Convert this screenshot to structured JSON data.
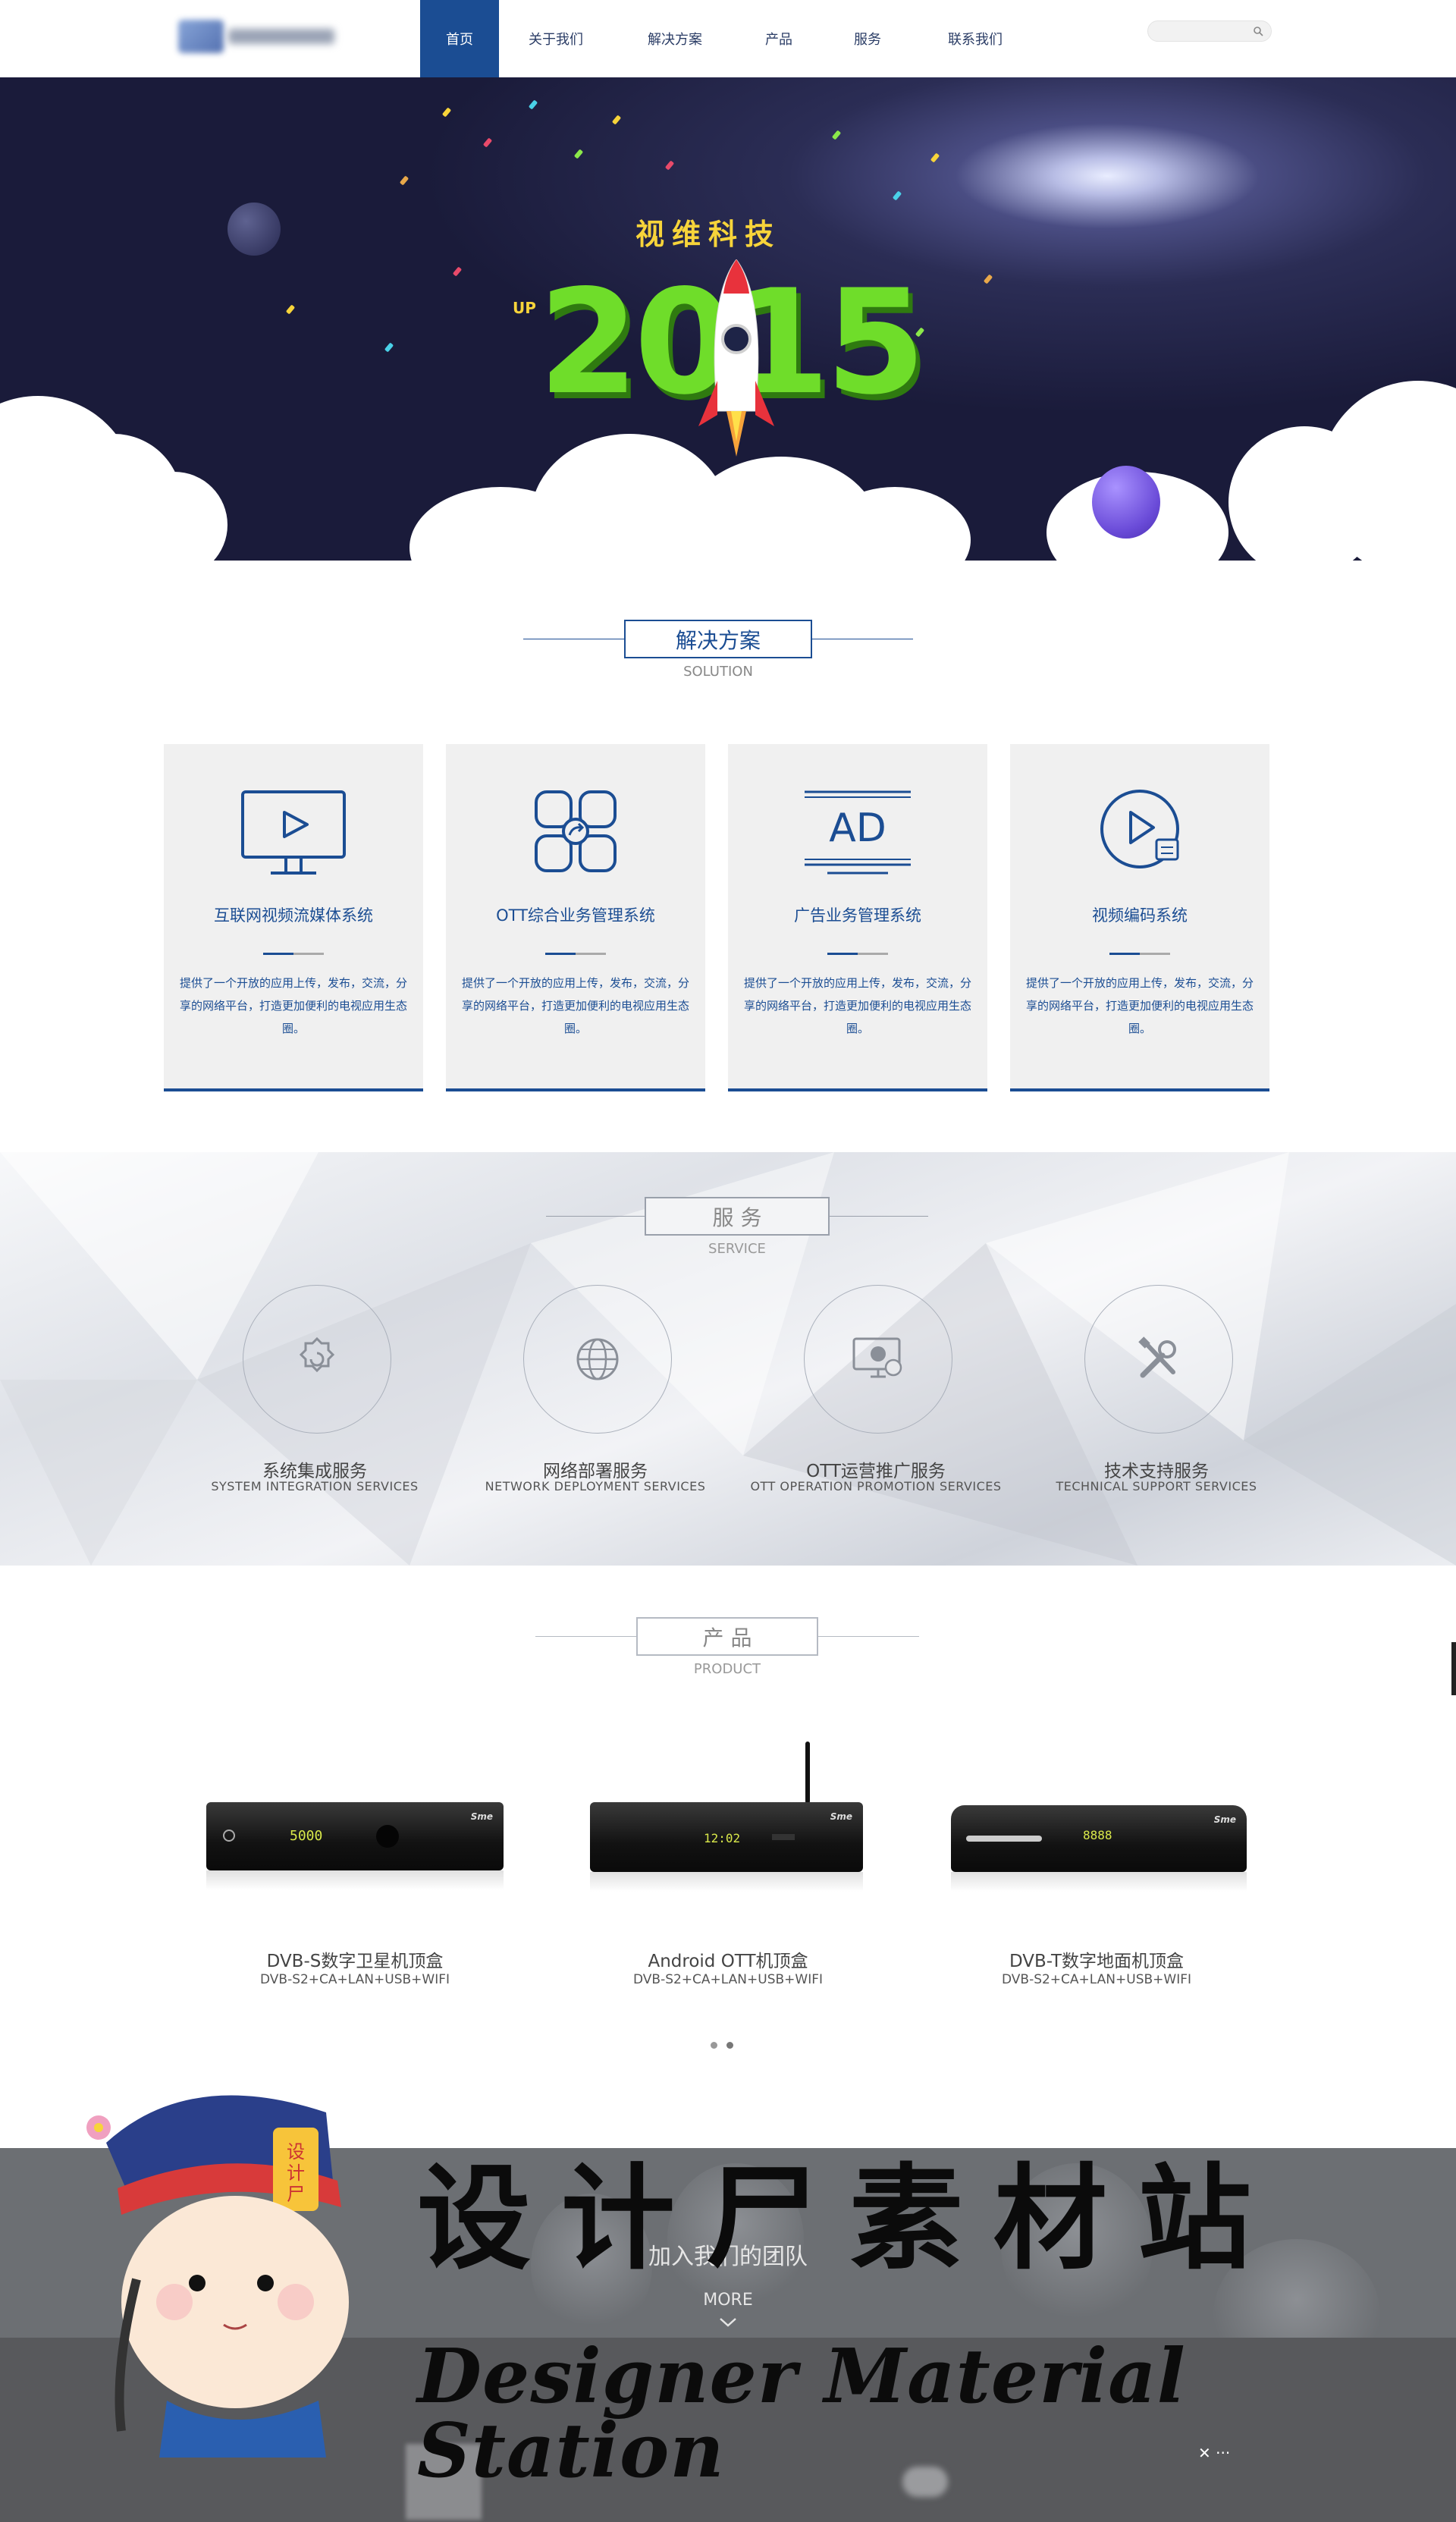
{
  "nav": {
    "items": [
      "首页",
      "关于我们",
      "解决方案",
      "产品",
      "服务",
      "联系我们"
    ],
    "active": "首页"
  },
  "search": {
    "placeholder": ""
  },
  "banner": {
    "title": "视维科技",
    "year": "2015",
    "up": "UP",
    "slides": 3,
    "active_slide": 1
  },
  "solution": {
    "title": "解决方案",
    "subtitle": "SOLUTION",
    "cards": [
      {
        "icon": "monitor-play-icon",
        "title": "互联网视频流媒体系统",
        "desc": "提供了一个开放的应用上传，发布，交流，分享的网络平台，打造更加便利的电视应用生态圈。"
      },
      {
        "icon": "apps-grid-icon",
        "title": "OTT综合业务管理系统",
        "desc": "提供了一个开放的应用上传，发布，交流，分享的网络平台，打造更加便利的电视应用生态圈。"
      },
      {
        "icon": "ad-screen-icon",
        "title": "广告业务管理系统",
        "desc": "提供了一个开放的应用上传，发布，交流，分享的网络平台，打造更加便利的电视应用生态圈。"
      },
      {
        "icon": "video-encode-icon",
        "title": "视频编码系统",
        "desc": "提供了一个开放的应用上传，发布，交流，分享的网络平台，打造更加便利的电视应用生态圈。"
      }
    ]
  },
  "service": {
    "title": "服 务",
    "subtitle": "SERVICE",
    "items": [
      {
        "icon": "gear-icon",
        "title": "系统集成服务",
        "sub": "SYSTEM INTEGRATION SERVICES"
      },
      {
        "icon": "globe-icon",
        "title": "网络部署服务",
        "sub": "NETWORK DEPLOYMENT SERVICES"
      },
      {
        "icon": "monitor-globe-icon",
        "title": "OTT运营推广服务",
        "sub": "OTT OPERATION PROMOTION SERVICES"
      },
      {
        "icon": "tools-icon",
        "title": "技术支持服务",
        "sub": "TECHNICAL SUPPORT SERVICES"
      }
    ]
  },
  "product": {
    "title": "产 品",
    "subtitle": "PRODUCT",
    "items": [
      {
        "title": "DVB-S数字卫星机顶盒",
        "sub": "DVB-S2+CA+LAN+USB+WIFI",
        "led": "5000"
      },
      {
        "title": "Android OTT机顶盒",
        "sub": "DVB-S2+CA+LAN+USB+WIFI",
        "led": "12:02"
      },
      {
        "title": "DVB-T数字地面机顶盒",
        "sub": "DVB-S2+CA+LAN+USB+WIFI",
        "led": "8888"
      }
    ],
    "pages": 2
  },
  "team": {
    "title": "加入我们的团队",
    "more": "MORE"
  },
  "watermark": {
    "cn": "设计尸素材站",
    "en": "Designer Material Station",
    "badge": "设计尸"
  },
  "colors": {
    "primary": "#1b4d93",
    "banner_dark": "#1a1b3a",
    "year_green": "#6fdd2a",
    "title_yellow": "#f7d43a"
  }
}
